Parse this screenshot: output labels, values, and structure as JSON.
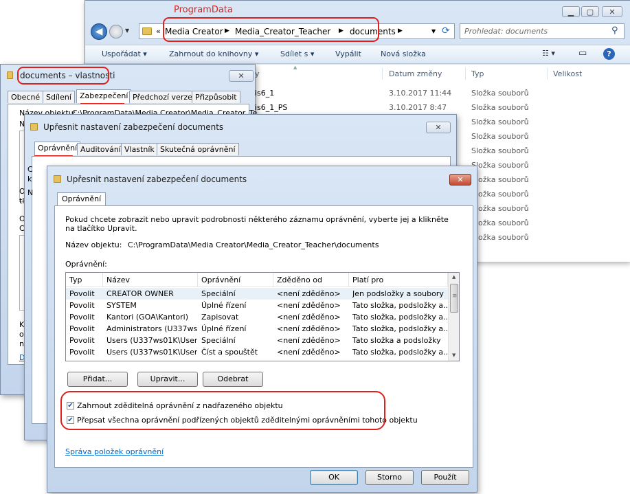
{
  "annotation": {
    "label": "ProgramData"
  },
  "explorer": {
    "breadcrumb": [
      "Media Creator",
      "Media_Creator_Teacher",
      "documents"
    ],
    "breadcrumb_overflow": "«",
    "search_placeholder": "Prohledat: documents",
    "toolbar": [
      "Uspořádat",
      "Zahrnout do knihovny",
      "Sdílet s",
      "Vypálit",
      "Nová složka"
    ],
    "columns": {
      "date": "Datum změny",
      "type": "Typ",
      "size": "Velikost",
      "name_fragment": "y"
    },
    "rows": [
      {
        "name": "is6_1",
        "date": "3.10.2017 11:44",
        "type": "Složka souborů"
      },
      {
        "name": "is6_1_PS",
        "date": "3.10.2017 8:47",
        "type": "Složka souborů"
      }
    ],
    "extra_types": [
      "Složka souborů",
      "Složka souborů",
      "Složka souborů",
      "Složka souborů",
      "Složka souborů",
      "Složka souborů",
      "Složka souborů",
      "Složka souborů",
      "Složka souborů",
      "Složka souborů"
    ]
  },
  "props": {
    "title": "documents – vlastnosti",
    "tabs": [
      "Obecné",
      "Sdílení",
      "Zabezpečení",
      "Předchozí verze",
      "Přizpůsobit"
    ],
    "object_label": "Název objektu:",
    "object_path": "C:\\ProgramData\\Media Creator\\Media_Creator_Te",
    "fragments": {
      "n": "N",
      "o1": "O",
      "tl": "tl",
      "o2": "O",
      "c": "C",
      "k": "K",
      "o3": "o",
      "n2": "n",
      "d": "D"
    }
  },
  "adv1": {
    "title": "Upřesnit nastavení zabezpečení documents",
    "tabs": [
      "Oprávnění",
      "Auditování",
      "Vlastník",
      "Skutečná oprávnění"
    ],
    "fragments": {
      "c": "C",
      "k": "k",
      "n": "N"
    }
  },
  "adv2": {
    "title": "Upřesnit nastavení zabezpečení documents",
    "tab": "Oprávnění",
    "description": "Pokud chcete zobrazit nebo upravit podrobnosti některého záznamu oprávnění, vyberte jej a klikněte na tlačítko Upravit.",
    "object_label": "Název objektu:",
    "object_path": "C:\\ProgramData\\Media Creator\\Media_Creator_Teacher\\documents",
    "permissions_label": "Oprávnění:",
    "columns": [
      "Typ",
      "Název",
      "Oprávnění",
      "Zděděno od",
      "Platí pro"
    ],
    "rows": [
      {
        "type": "Povolit",
        "name": "CREATOR OWNER",
        "perm": "Speciální",
        "inherited": "<není zděděno>",
        "applies": "Jen podsložky a soubory"
      },
      {
        "type": "Povolit",
        "name": "SYSTEM",
        "perm": "Úplné řízení",
        "inherited": "<není zděděno>",
        "applies": "Tato složka, podsložky a..."
      },
      {
        "type": "Povolit",
        "name": "Kantori (GOA\\Kantori)",
        "perm": "Zapisovat",
        "inherited": "<není zděděno>",
        "applies": "Tato složka, podsložky a..."
      },
      {
        "type": "Povolit",
        "name": "Administrators (U337ws...",
        "perm": "Úplné řízení",
        "inherited": "<není zděděno>",
        "applies": "Tato složka, podsložky a..."
      },
      {
        "type": "Povolit",
        "name": "Users (U337ws01K\\Users)",
        "perm": "Speciální",
        "inherited": "<není zděděno>",
        "applies": "Tato složka a podsložky"
      },
      {
        "type": "Povolit",
        "name": "Users (U337ws01K\\Users)",
        "perm": "Číst a spouštět",
        "inherited": "<není zděděno>",
        "applies": "Tato složka, podsložky a..."
      }
    ],
    "buttons": {
      "add": "Přidat...",
      "edit": "Upravit...",
      "remove": "Odebrat"
    },
    "checkbox_inherit": {
      "label": "Zahrnout zděditelná oprávnění z nadřazeného objektu",
      "checked": true
    },
    "checkbox_replace": {
      "label": "Přepsat všechna oprávnění podřízených objektů zděditelnými oprávněními tohoto objektu",
      "checked": true
    },
    "manage_link": "Správa položek oprávnění",
    "footer": {
      "ok": "OK",
      "cancel": "Storno",
      "apply": "Použít"
    }
  }
}
